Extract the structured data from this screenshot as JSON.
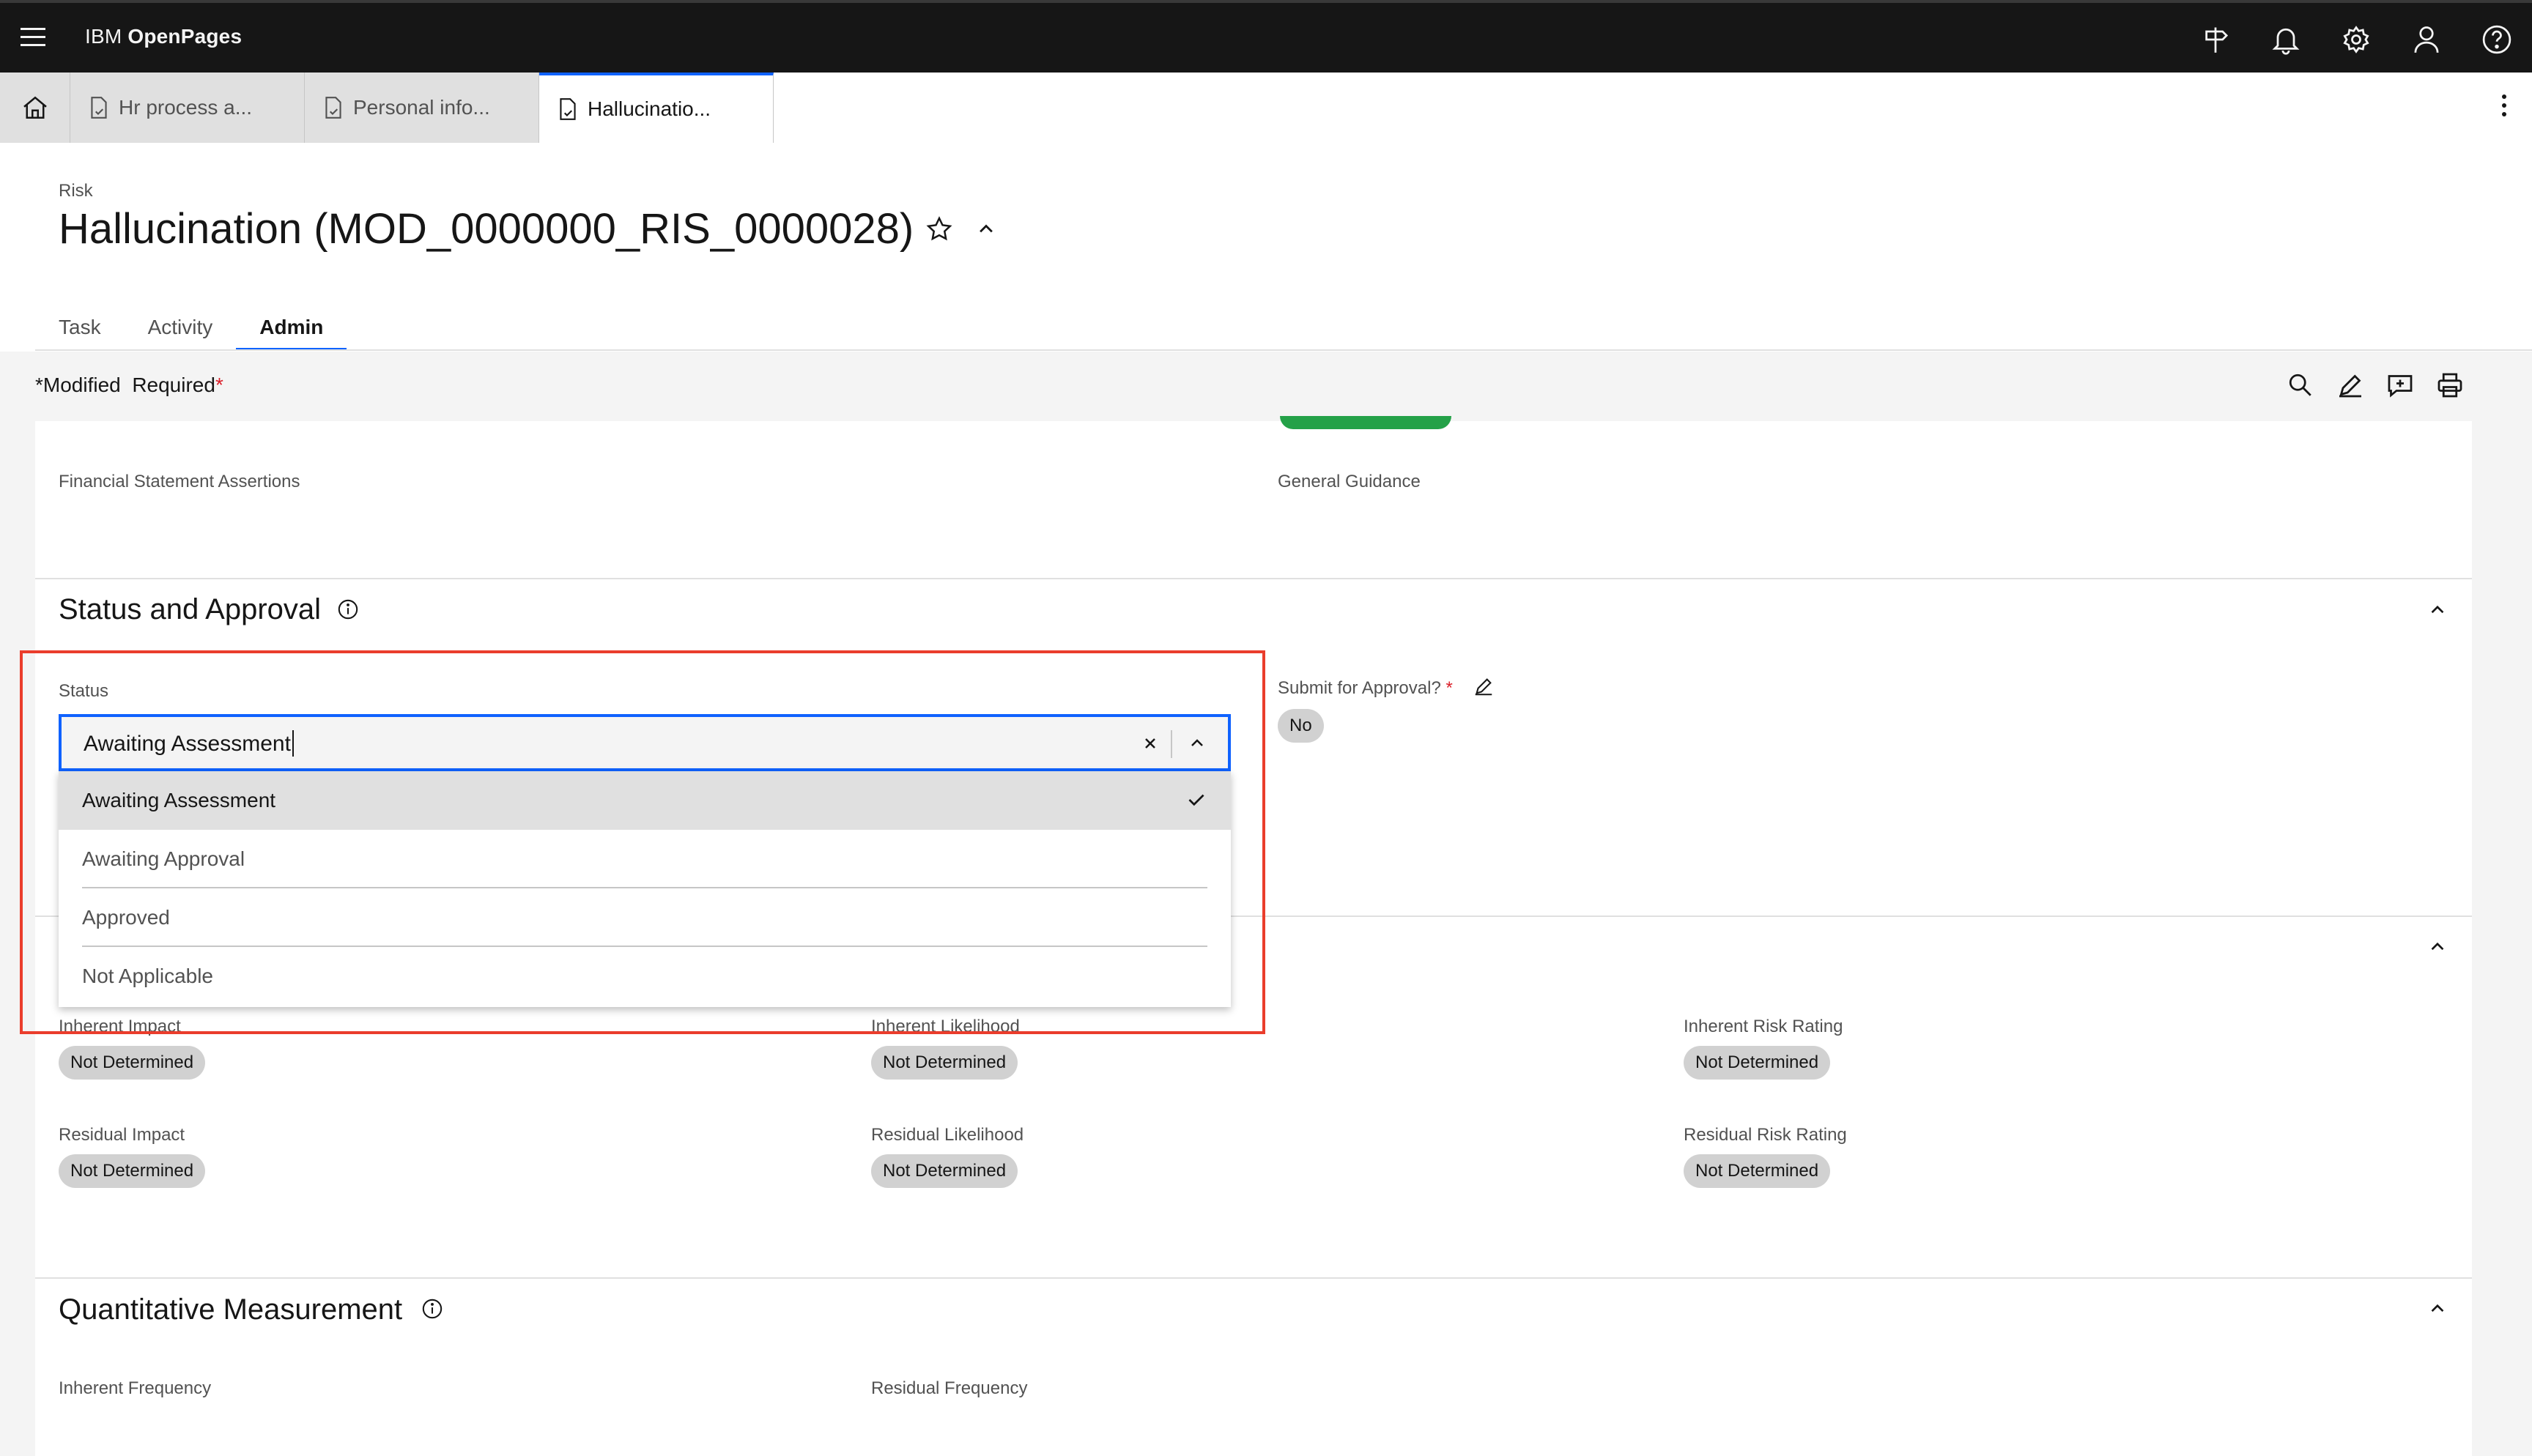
{
  "topbar": {
    "brand_prefix": "IBM",
    "brand_name": "OpenPages",
    "icons": [
      "signpost-icon",
      "bell-icon",
      "gear-icon",
      "user-icon",
      "help-icon"
    ]
  },
  "tabs_bar": {
    "home_icon": "home-icon",
    "doc_tabs": [
      {
        "label": "Hr process a...",
        "icon": "document-icon"
      },
      {
        "label": "Personal info...",
        "icon": "document-icon"
      },
      {
        "label": "Hallucinatio...",
        "icon": "document-icon",
        "active": true
      }
    ],
    "overflow_icon": "overflow-menu-icon"
  },
  "header": {
    "breadcrumb": "Risk",
    "title": "Hallucination (MOD_0000000_RIS_0000028)",
    "tabs": [
      "Task",
      "Activity",
      "Admin"
    ],
    "active_tab": "Admin"
  },
  "toolbar": {
    "modified": "Modified",
    "required": "Required",
    "icons": [
      "search-icon",
      "edit-icon",
      "add-comment-icon",
      "print-icon"
    ]
  },
  "fields_top": {
    "financial_statement_assertions": "Financial Statement Assertions",
    "general_guidance": "General Guidance"
  },
  "status_section": {
    "title": "Status and Approval",
    "status_label": "Status",
    "status_value": "Awaiting Assessment",
    "options": [
      "Awaiting Assessment",
      "Awaiting Approval",
      "Approved",
      "Not Applicable"
    ],
    "selected_index": 0,
    "submit_label": "Submit for Approval?",
    "submit_required_mark": "*",
    "submit_value": "No"
  },
  "risk_section": {
    "inherent_impact_label": "Inherent Impact",
    "inherent_impact_value": "Not Determined",
    "inherent_likelihood_label": "Inherent Likelihood",
    "inherent_likelihood_value": "Not Determined",
    "inherent_rating_label": "Inherent Risk Rating",
    "inherent_rating_value": "Not Determined",
    "residual_impact_label": "Residual Impact",
    "residual_impact_value": "Not Determined",
    "residual_likelihood_label": "Residual Likelihood",
    "residual_likelihood_value": "Not Determined",
    "residual_rating_label": "Residual Risk Rating",
    "residual_rating_value": "Not Determined"
  },
  "quant_section": {
    "title": "Quantitative Measurement",
    "inherent_frequency_label": "Inherent Frequency",
    "residual_frequency_label": "Residual Frequency"
  },
  "colors": {
    "accent": "#0f62fe",
    "highlight_box": "#ea3d2c",
    "required": "#da1e28",
    "status_green": "#24a148"
  }
}
